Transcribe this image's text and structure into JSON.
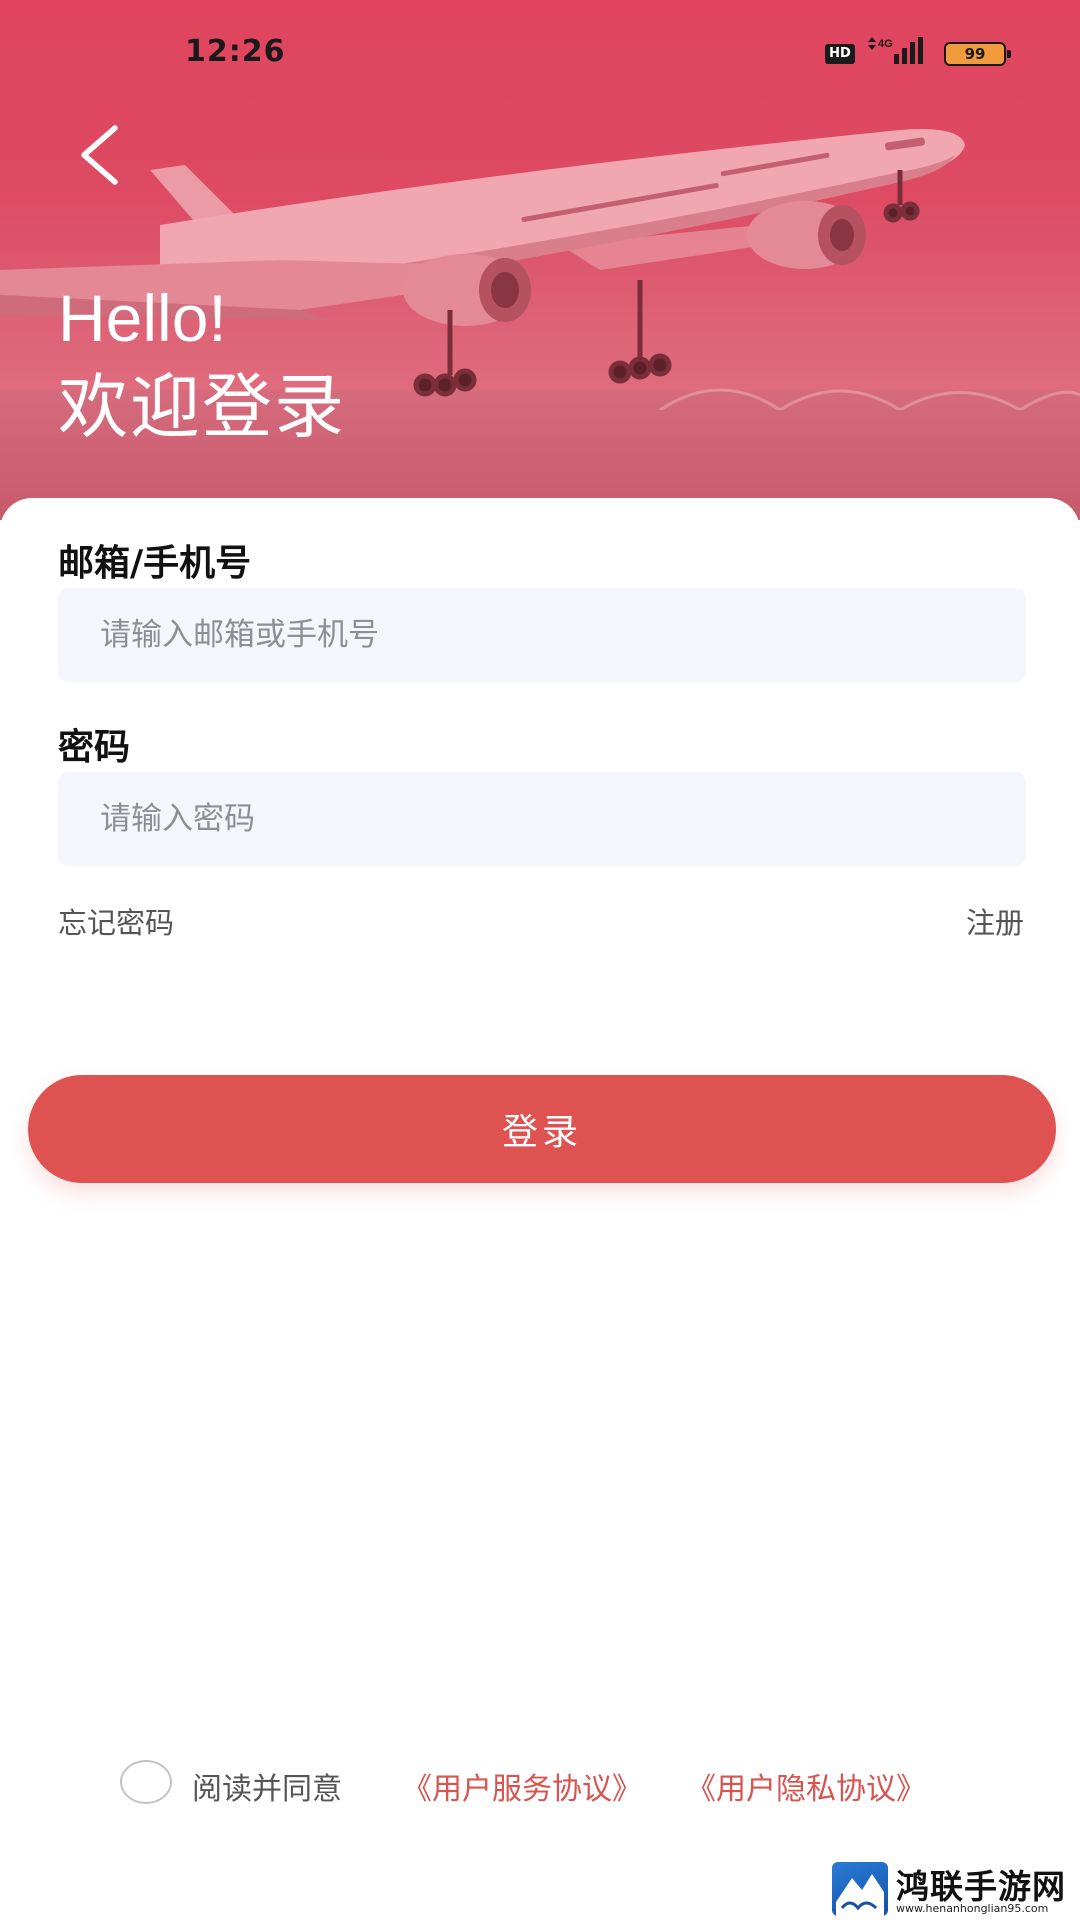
{
  "status_bar": {
    "time": "12:26",
    "hd_badge": "HD",
    "network": "4G",
    "battery": "99"
  },
  "hero": {
    "greeting": "Hello!",
    "welcome": "欢迎登录",
    "back_icon": "chevron-left-icon"
  },
  "form": {
    "account_label": "邮箱/手机号",
    "account_placeholder": "请输入邮箱或手机号",
    "account_value": "",
    "password_label": "密码",
    "password_placeholder": "请输入密码",
    "password_value": "",
    "forgot_label": "忘记密码",
    "register_label": "注册",
    "login_label": "登录"
  },
  "agreement": {
    "checked": false,
    "prefix": "阅读并同意",
    "terms_link": "《用户服务协议》",
    "privacy_link": "《用户隐私协议》"
  },
  "watermark": {
    "title": "鸿联手游网",
    "url": "www.henanhonglian95.com"
  },
  "colors": {
    "hero": "#de4a62",
    "button": "#de5352",
    "link": "#d8544f",
    "input_bg": "#f4f6fb"
  }
}
